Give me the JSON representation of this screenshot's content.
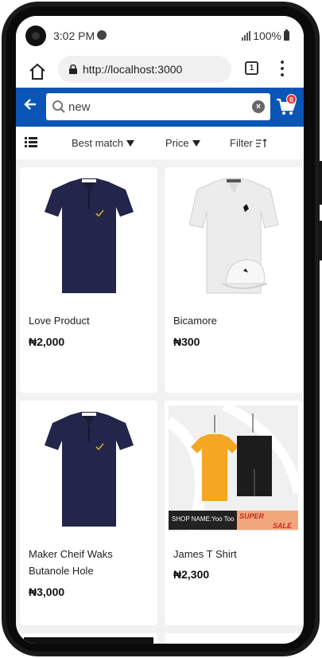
{
  "status": {
    "time": "3:02 PM",
    "battery": "100%"
  },
  "browser": {
    "url": "http://localhost:3000",
    "tab_count": "1"
  },
  "header": {
    "search_value": "new",
    "cart_count": "0"
  },
  "toolbar": {
    "best_match": "Best match",
    "price": "Price",
    "filter": "Filter"
  },
  "products": [
    {
      "name": "Love Product",
      "price": "₦2,000"
    },
    {
      "name": "Bicamore",
      "price": "₦300"
    },
    {
      "name": "Maker Cheif Waks Butanole Hole",
      "price": "₦3,000"
    },
    {
      "name": "James T Shirt",
      "price": "₦2,300"
    }
  ],
  "banner": {
    "shop_name": "SHOP NAME:Yoo Too",
    "sale_line1": "SUPER",
    "sale_line2": "SALE"
  },
  "colors": {
    "accent": "#0a55b5",
    "badge": "#e53935",
    "navy_shirt": "#23264a"
  }
}
